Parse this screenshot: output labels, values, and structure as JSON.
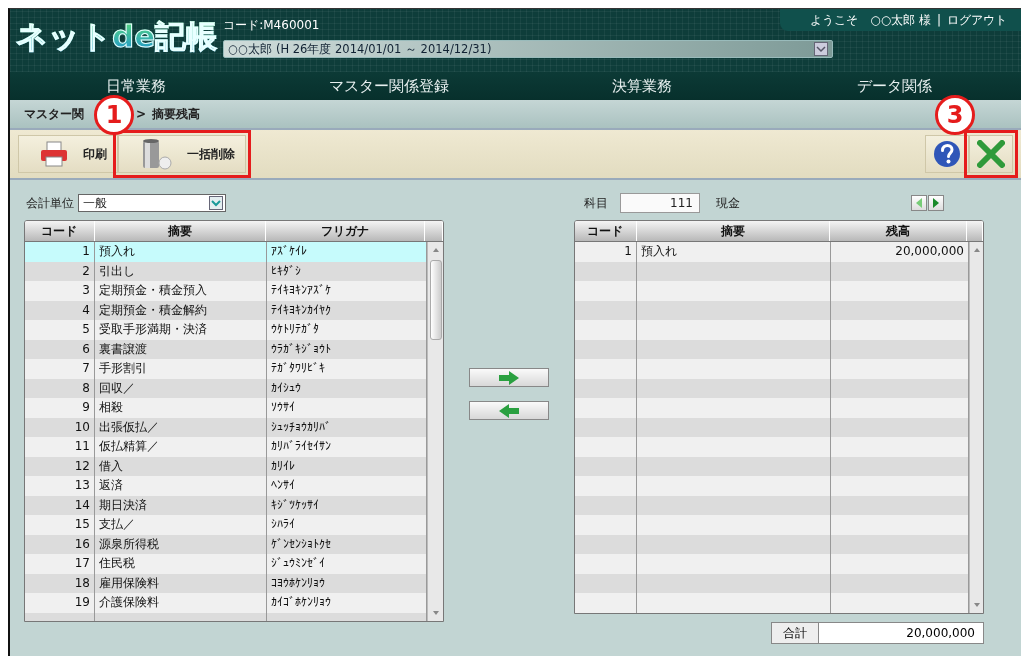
{
  "header": {
    "logo": "ネットde記帳",
    "code": "コード:M460001",
    "period": "○○太郎 (H 26年度 2014/01/01 ～ 2014/12/31)",
    "welcome": "ようこそ　○○太郎 様",
    "separator": "|",
    "logout": "ログアウト"
  },
  "nav": [
    {
      "label": "日常業務"
    },
    {
      "label": "マスター関係登録"
    },
    {
      "label": "決算業務"
    },
    {
      "label": "データ関係"
    }
  ],
  "breadcrumb": {
    "parent": "マスター関",
    "separator": ">",
    "current": "摘要残高"
  },
  "toolbar": {
    "left": [
      {
        "kind": "print",
        "label": "印刷",
        "highlighted": false
      },
      {
        "kind": "bulk-delete",
        "label": "一括削除",
        "highlighted": true,
        "callout": "1"
      }
    ],
    "right": [
      {
        "kind": "help",
        "highlighted": false
      },
      {
        "kind": "close",
        "highlighted": true,
        "callout": "3"
      }
    ]
  },
  "left": {
    "unit_label": "会計単位",
    "unit_value": "一般",
    "columns": [
      "コード",
      "摘要",
      "フリガナ"
    ],
    "rows": [
      {
        "code": "1",
        "summary": "預入れ",
        "kana": "ｱｽﾞｹｲﾚ",
        "selected": true
      },
      {
        "code": "2",
        "summary": "引出し",
        "kana": "ﾋｷﾀﾞｼ",
        "selected": false
      },
      {
        "code": "3",
        "summary": "定期預金・積金預入",
        "kana": "ﾃｲｷﾖｷﾝｱｽﾞｹ",
        "selected": false
      },
      {
        "code": "4",
        "summary": "定期預金・積金解約",
        "kana": "ﾃｲｷﾖｷﾝｶｲﾔｸ",
        "selected": false
      },
      {
        "code": "5",
        "summary": "受取手形満期・決済",
        "kana": "ｳｹﾄﾘﾃｶﾞﾀ",
        "selected": false
      },
      {
        "code": "6",
        "summary": "裏書譲渡",
        "kana": "ｳﾗｶﾞｷｼﾞｮｳﾄ",
        "selected": false
      },
      {
        "code": "7",
        "summary": "手形割引",
        "kana": "ﾃｶﾞﾀﾜﾘﾋﾞｷ",
        "selected": false
      },
      {
        "code": "8",
        "summary": "回収／",
        "kana": "ｶｲｼｭｳ",
        "selected": false
      },
      {
        "code": "9",
        "summary": "相殺",
        "kana": "ｿｳｻｲ",
        "selected": false
      },
      {
        "code": "10",
        "summary": "出張仮払／",
        "kana": "ｼｭｯﾁｮｳｶﾘﾊﾞ",
        "selected": false
      },
      {
        "code": "11",
        "summary": "仮払精算／",
        "kana": "ｶﾘﾊﾞﾗｲｾｲｻﾝ",
        "selected": false
      },
      {
        "code": "12",
        "summary": "借入",
        "kana": "ｶﾘｲﾚ",
        "selected": false
      },
      {
        "code": "13",
        "summary": "返済",
        "kana": "ﾍﾝｻｲ",
        "selected": false
      },
      {
        "code": "14",
        "summary": "期日決済",
        "kana": "ｷｼﾞﾂｹｯｻｲ",
        "selected": false
      },
      {
        "code": "15",
        "summary": "支払／",
        "kana": "ｼﾊﾗｲ",
        "selected": false
      },
      {
        "code": "16",
        "summary": "源泉所得税",
        "kana": "ｹﾞﾝｾﾝｼｮﾄｸｾ",
        "selected": false
      },
      {
        "code": "17",
        "summary": "住民税",
        "kana": "ｼﾞｭｳﾐﾝｾﾞｲ",
        "selected": false
      },
      {
        "code": "18",
        "summary": "雇用保険料",
        "kana": "ｺﾖｳﾎｹﾝﾘｮｳ",
        "selected": false
      },
      {
        "code": "19",
        "summary": "介護保険料",
        "kana": "ｶｲｺﾞﾎｹﾝﾘｮｳ",
        "selected": false
      }
    ]
  },
  "right": {
    "account_label": "科目",
    "account_code": "111",
    "account_name": "現金",
    "columns": [
      "コード",
      "摘要",
      "残高"
    ],
    "rows": [
      {
        "code": "1",
        "summary": "預入れ",
        "balance": "20,000,000"
      }
    ],
    "total_label": "合計",
    "total_value": "20,000,000"
  }
}
